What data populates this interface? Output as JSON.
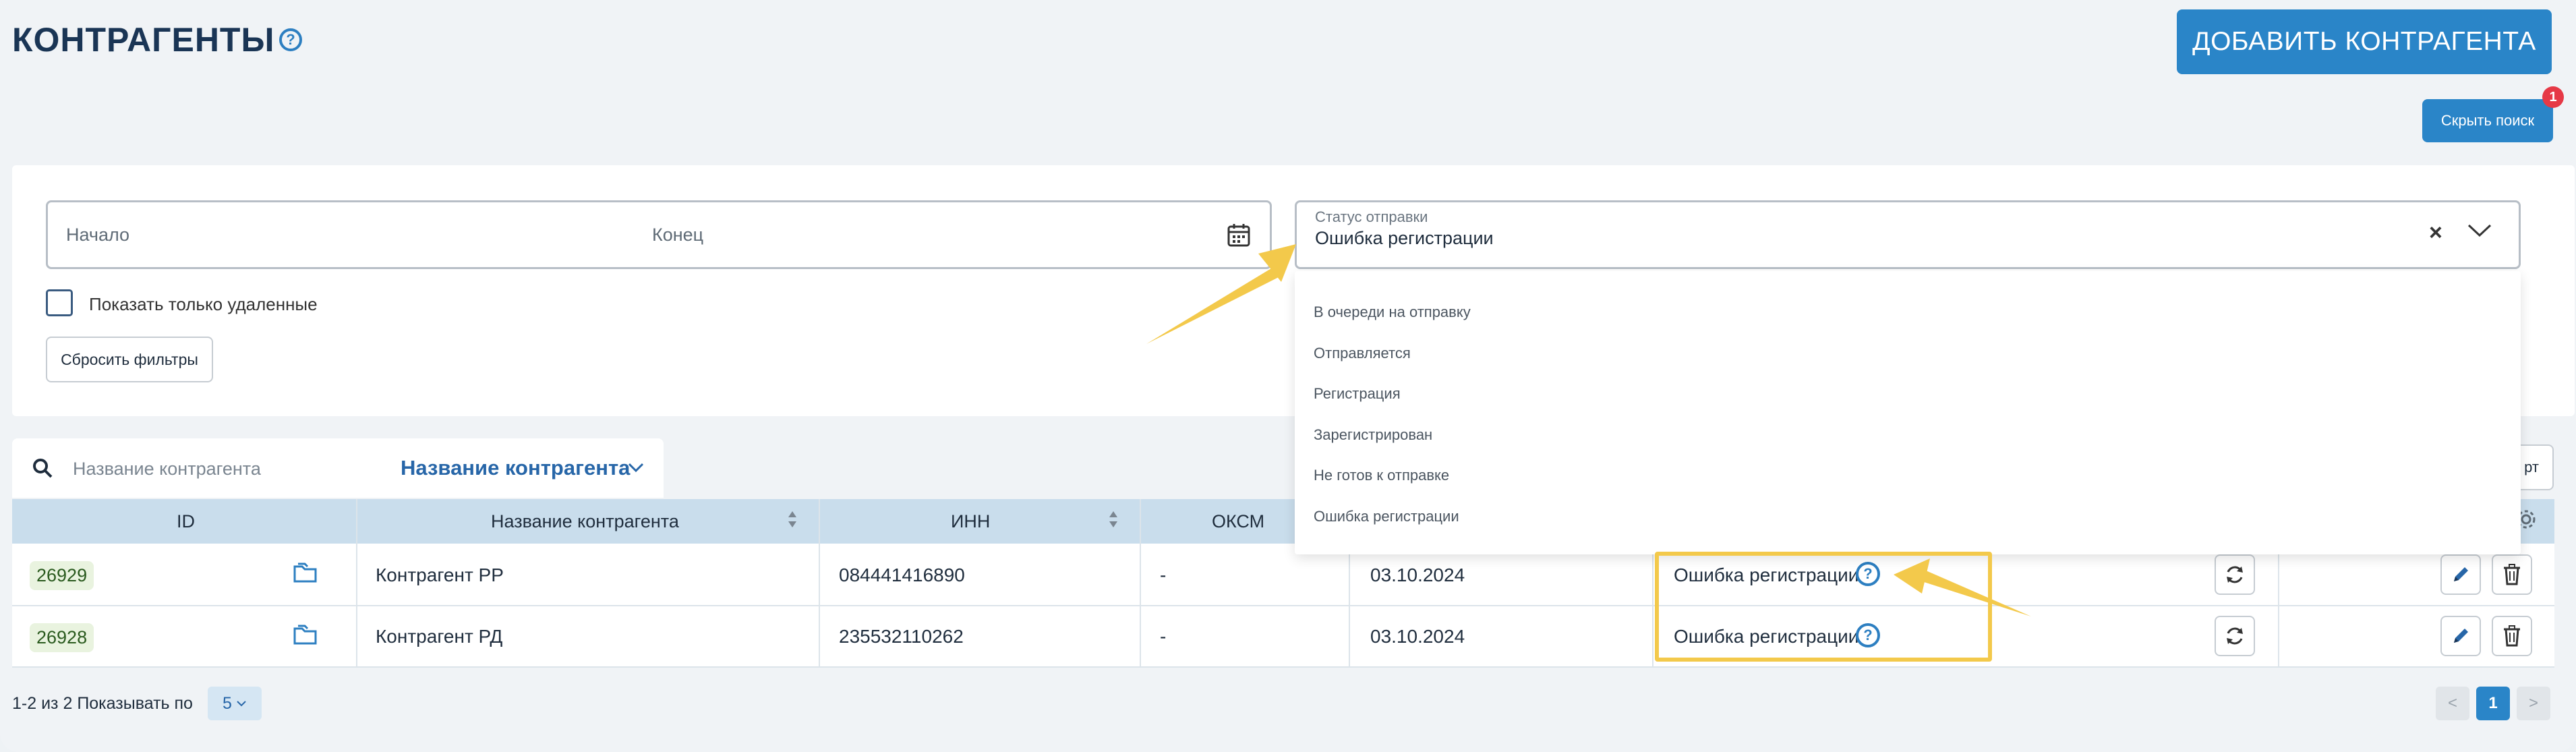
{
  "header": {
    "title": "КОНТРАГЕНТЫ",
    "help_glyph": "?",
    "add_button": "ДОБАВИТЬ КОНТРАГЕНТА",
    "hide_search_button": "Скрыть поиск",
    "filter_badge": "1"
  },
  "filters": {
    "date_start_placeholder": "Начало",
    "date_end_placeholder": "Конец",
    "status_label": "Статус отправки",
    "status_value": "Ошибка регистрации",
    "show_deleted_label": "Показать только удаленные",
    "reset_button": "Сбросить фильтры",
    "status_options": [
      "В очереди на отправку",
      "Отправляется",
      "Регистрация",
      "Зарегистрирован",
      "Не готов к отправке",
      "Ошибка регистрации"
    ]
  },
  "search": {
    "placeholder": "Название контрагента",
    "mode": "Название контрагента",
    "export_button": "рт"
  },
  "table": {
    "columns": [
      "ID",
      "Название контрагента",
      "ИНН",
      "ОКСМ"
    ],
    "rows": [
      {
        "id": "26929",
        "name": "Контрагент РР",
        "inn": "084441416890",
        "oksm": "-",
        "date": "03.10.2024",
        "status": "Ошибка регистрации"
      },
      {
        "id": "26928",
        "name": "Контрагент РД",
        "inn": "235532110262",
        "oksm": "-",
        "date": "03.10.2024",
        "status": "Ошибка регистрации"
      }
    ]
  },
  "pagination": {
    "summary": "1-2 из 2",
    "per_page_label": "Показывать по",
    "per_page_value": "5",
    "current_page": "1",
    "prev": "<",
    "next": ">"
  },
  "colors": {
    "accent": "#2a85c8",
    "header_row": "#c9ddec",
    "annotation": "#f3c94b",
    "badge": "#e63946"
  }
}
